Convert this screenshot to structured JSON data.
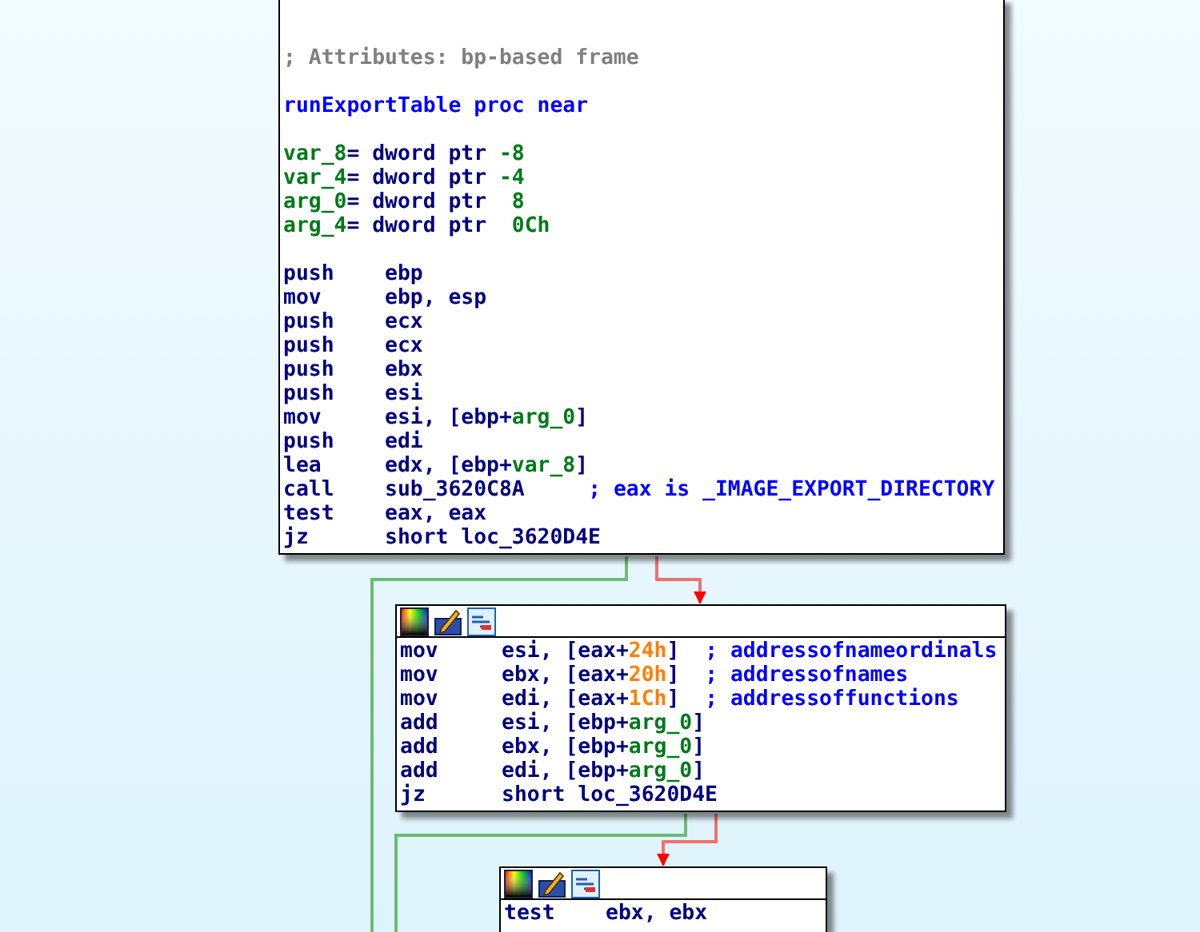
{
  "nodes": [
    {
      "header": false,
      "blocks": [
        [
          [
            {
              "kind": "note",
              "text": "; Attributes: bp-based frame"
            }
          ]
        ],
        [
          [
            {
              "kind": "label",
              "text": "runExportTable proc near"
            }
          ]
        ],
        [
          [
            {
              "kind": "var",
              "text": "var_8"
            },
            {
              "kind": "code",
              "text": "= dword ptr "
            },
            {
              "kind": "num",
              "text": "-8"
            }
          ],
          [
            {
              "kind": "var",
              "text": "var_4"
            },
            {
              "kind": "code",
              "text": "= dword ptr "
            },
            {
              "kind": "num",
              "text": "-4"
            }
          ],
          [
            {
              "kind": "var",
              "text": "arg_0"
            },
            {
              "kind": "code",
              "text": "= dword ptr  "
            },
            {
              "kind": "num",
              "text": "8"
            }
          ],
          [
            {
              "kind": "var",
              "text": "arg_4"
            },
            {
              "kind": "code",
              "text": "= dword ptr  "
            },
            {
              "kind": "num",
              "text": "0Ch"
            }
          ]
        ],
        [
          [
            {
              "kind": "code",
              "text": "push    ebp"
            }
          ],
          [
            {
              "kind": "code",
              "text": "mov     ebp, esp"
            }
          ],
          [
            {
              "kind": "code",
              "text": "push    ecx"
            }
          ],
          [
            {
              "kind": "code",
              "text": "push    ecx"
            }
          ],
          [
            {
              "kind": "code",
              "text": "push    ebx"
            }
          ],
          [
            {
              "kind": "code",
              "text": "push    esi"
            }
          ],
          [
            {
              "kind": "code",
              "text": "mov     esi, [ebp+"
            },
            {
              "kind": "var",
              "text": "arg_0"
            },
            {
              "kind": "code",
              "text": "]"
            }
          ],
          [
            {
              "kind": "code",
              "text": "push    edi"
            }
          ],
          [
            {
              "kind": "code",
              "text": "lea     edx, [ebp+"
            },
            {
              "kind": "var",
              "text": "var_8"
            },
            {
              "kind": "code",
              "text": "]"
            }
          ],
          [
            {
              "kind": "code",
              "text": "call    sub_3620C8A     "
            },
            {
              "kind": "comment",
              "text": "; eax is _IMAGE_EXPORT_DIRECTORY"
            }
          ],
          [
            {
              "kind": "code",
              "text": "test    eax, eax"
            }
          ],
          [
            {
              "kind": "code",
              "text": "jz      short loc_3620D4E"
            }
          ]
        ]
      ]
    },
    {
      "header": true,
      "blocks": [
        [
          [
            {
              "kind": "code",
              "text": "mov     esi, [eax+"
            },
            {
              "kind": "hex",
              "text": "24h"
            },
            {
              "kind": "code",
              "text": "]  "
            },
            {
              "kind": "comment",
              "text": "; addressofnameordinals"
            }
          ],
          [
            {
              "kind": "code",
              "text": "mov     ebx, [eax+"
            },
            {
              "kind": "hex",
              "text": "20h"
            },
            {
              "kind": "code",
              "text": "]  "
            },
            {
              "kind": "comment",
              "text": "; addressofnames"
            }
          ],
          [
            {
              "kind": "code",
              "text": "mov     edi, [eax+"
            },
            {
              "kind": "hex",
              "text": "1Ch"
            },
            {
              "kind": "code",
              "text": "]  "
            },
            {
              "kind": "comment",
              "text": "; addressoffunctions"
            }
          ],
          [
            {
              "kind": "code",
              "text": "add     esi, [ebp+"
            },
            {
              "kind": "var",
              "text": "arg_0"
            },
            {
              "kind": "code",
              "text": "]"
            }
          ],
          [
            {
              "kind": "code",
              "text": "add     ebx, [ebp+"
            },
            {
              "kind": "var",
              "text": "arg_0"
            },
            {
              "kind": "code",
              "text": "]"
            }
          ],
          [
            {
              "kind": "code",
              "text": "add     edi, [ebp+"
            },
            {
              "kind": "var",
              "text": "arg_0"
            },
            {
              "kind": "code",
              "text": "]"
            }
          ],
          [
            {
              "kind": "code",
              "text": "jz      short loc_3620D4E"
            }
          ]
        ]
      ]
    },
    {
      "header": true,
      "blocks": [
        [
          [
            {
              "kind": "code",
              "text": "test    ebx, ebx"
            }
          ]
        ]
      ]
    }
  ]
}
